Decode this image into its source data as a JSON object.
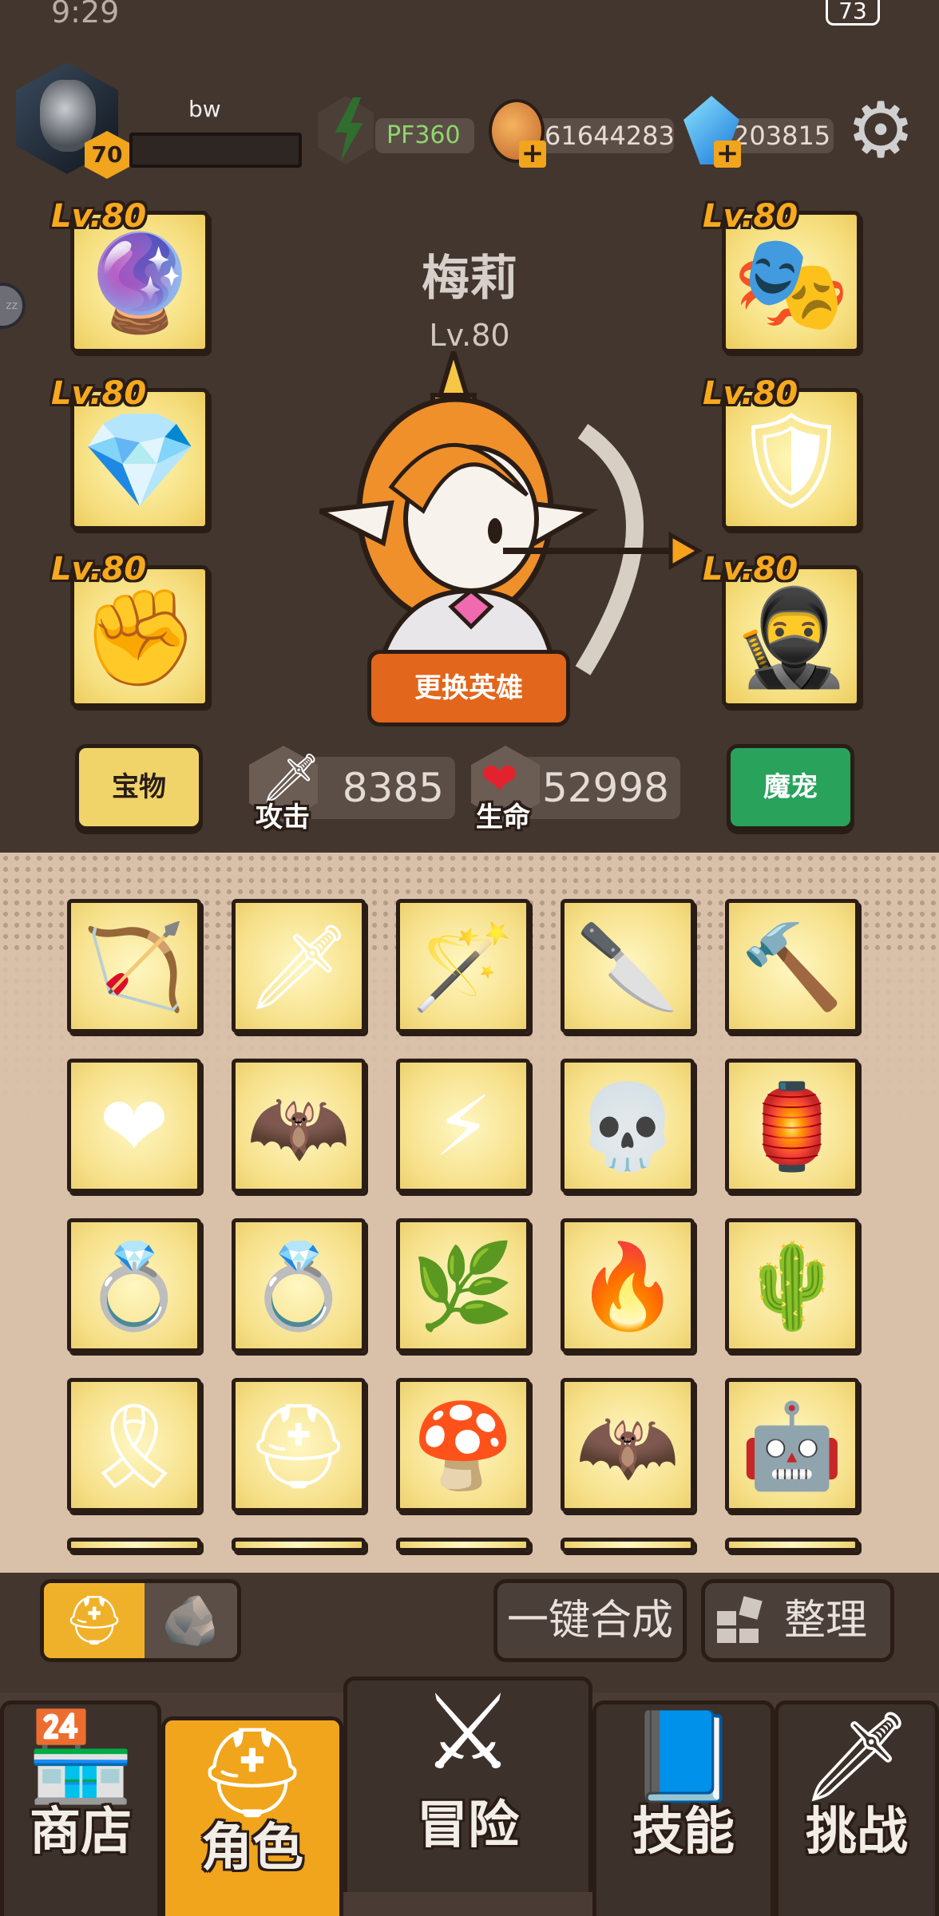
{
  "status": {
    "time": "9:29",
    "battery": "73"
  },
  "player": {
    "name": "bw",
    "level": "70"
  },
  "resources": {
    "energy": "PF360",
    "coins": "61644283",
    "gems": "203815"
  },
  "equipment": {
    "left": [
      {
        "level": "Lv.80",
        "icon": "staff-icon",
        "glyph": "🔮"
      },
      {
        "level": "Lv.80",
        "icon": "crystal-necklace-icon",
        "glyph": "💎"
      },
      {
        "level": "Lv.80",
        "icon": "fist-ring-icon",
        "glyph": "✊"
      }
    ],
    "right": [
      {
        "level": "Lv.80",
        "icon": "helmet-icon",
        "glyph": "🎭"
      },
      {
        "level": "Lv.80",
        "icon": "armor-icon",
        "glyph": "🛡"
      },
      {
        "level": "Lv.80",
        "icon": "dark-armor-icon",
        "glyph": "🥷"
      }
    ]
  },
  "hero": {
    "name": "梅莉",
    "level": "Lv.80",
    "change_label": "更换英雄"
  },
  "stats": {
    "treasure_label": "宝物",
    "attack_label": "攻击",
    "attack_value": "8385",
    "hp_label": "生命",
    "hp_value": "52998",
    "pet_label": "魔宠"
  },
  "inventory": [
    [
      {
        "icon": "bow-icon",
        "glyph": "🏹"
      },
      {
        "icon": "sword-icon",
        "glyph": "🗡"
      },
      {
        "icon": "wand-icon",
        "glyph": "🪄"
      },
      {
        "icon": "golden-blade-icon",
        "glyph": "🔪"
      },
      {
        "icon": "hammer-icon",
        "glyph": "🔨"
      }
    ],
    [
      {
        "icon": "heart-necklace-icon",
        "glyph": "❤"
      },
      {
        "icon": "bat-necklace-icon",
        "glyph": "🦇"
      },
      {
        "icon": "bolt-necklace-icon",
        "glyph": "⚡"
      },
      {
        "icon": "skull-necklace-icon",
        "glyph": "💀"
      },
      {
        "icon": "lantern-necklace-icon",
        "glyph": "🏮"
      }
    ],
    [
      {
        "icon": "blue-ring-icon",
        "glyph": "💍"
      },
      {
        "icon": "purple-ring-icon",
        "glyph": "💍"
      },
      {
        "icon": "vine-ring-icon",
        "glyph": "🌿"
      },
      {
        "icon": "flame-ring-icon",
        "glyph": "🔥"
      },
      {
        "icon": "thorn-ring-icon",
        "glyph": "🌵"
      }
    ],
    [
      {
        "icon": "leaf-headband-icon",
        "glyph": "🎗"
      },
      {
        "icon": "knight-helmet-icon",
        "glyph": "⛑"
      },
      {
        "icon": "mushroom-hat-icon",
        "glyph": "🍄"
      },
      {
        "icon": "bat-helmet-icon",
        "glyph": "🦇"
      },
      {
        "icon": "robot-helmet-icon",
        "glyph": "🤖"
      }
    ]
  ],
  "toolbar": {
    "merge_label": "一键合成",
    "sort_label": "整理"
  },
  "nav": [
    {
      "label": "商店",
      "icon": "shop-icon",
      "glyph": "🏪"
    },
    {
      "label": "角色",
      "icon": "helmet-icon",
      "glyph": "⛑"
    },
    {
      "label": "冒险",
      "icon": "crossed-swords-icon",
      "glyph": "⚔"
    },
    {
      "label": "技能",
      "icon": "spellbook-icon",
      "glyph": "📘"
    },
    {
      "label": "挑战",
      "icon": "flag-sword-icon",
      "glyph": "🗡"
    }
  ],
  "colors": {
    "accent": "#f0a51c",
    "pet_button": "#29a25c",
    "change_hero": "#e2661b",
    "background": "#43362f"
  }
}
